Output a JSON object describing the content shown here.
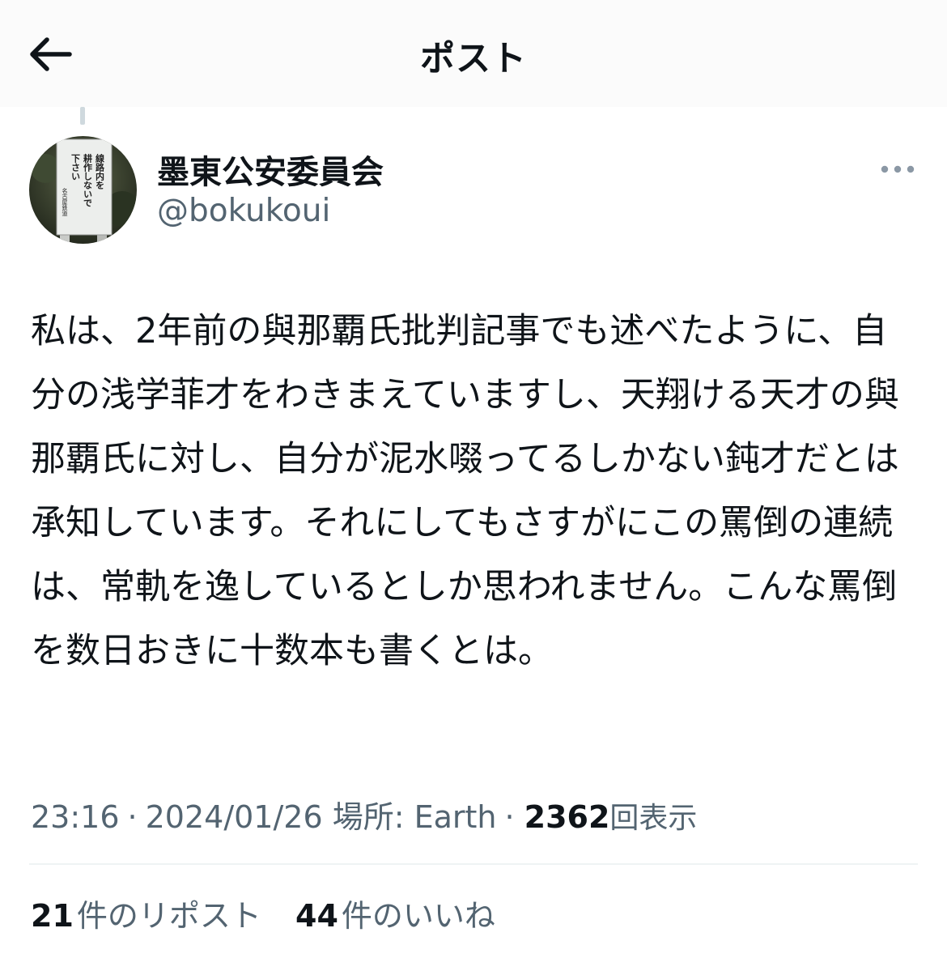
{
  "header": {
    "title": "ポスト",
    "back_icon": "arrow-left-icon"
  },
  "post": {
    "author": {
      "display_name": "墨東公安委員会",
      "handle": "@bokukoui",
      "avatar_sign_text": [
        "線路内を",
        "耕作しないで",
        "下さい",
        "名古屋鉄道"
      ]
    },
    "more_icon": "more-horizontal-icon",
    "text": "私は、2年前の與那覇氏批判記事でも述べたように、自分の浅学菲才をわきまえていますし、天翔ける天才の與那覇氏に対し、自分が泥水啜ってるしかない鈍才だとは承知しています。それにしてもさすがにこの罵倒の連続は、常軌を逸しているとしか思われません。こんな罵倒を数日おきに十数本も書くとは。",
    "meta": {
      "time": "23:16",
      "date": "2024/01/26",
      "location": "場所: Earth",
      "separator": "·",
      "views_count": "2362",
      "views_label": "回表示"
    },
    "stats": {
      "reposts_count": "21",
      "reposts_label": "件のリポスト",
      "likes_count": "44",
      "likes_label": "件のいいね"
    }
  },
  "colors": {
    "text_primary": "#0f1419",
    "text_secondary": "#536471",
    "divider": "#eff3f4",
    "header_bg": "#fbfbfb"
  }
}
